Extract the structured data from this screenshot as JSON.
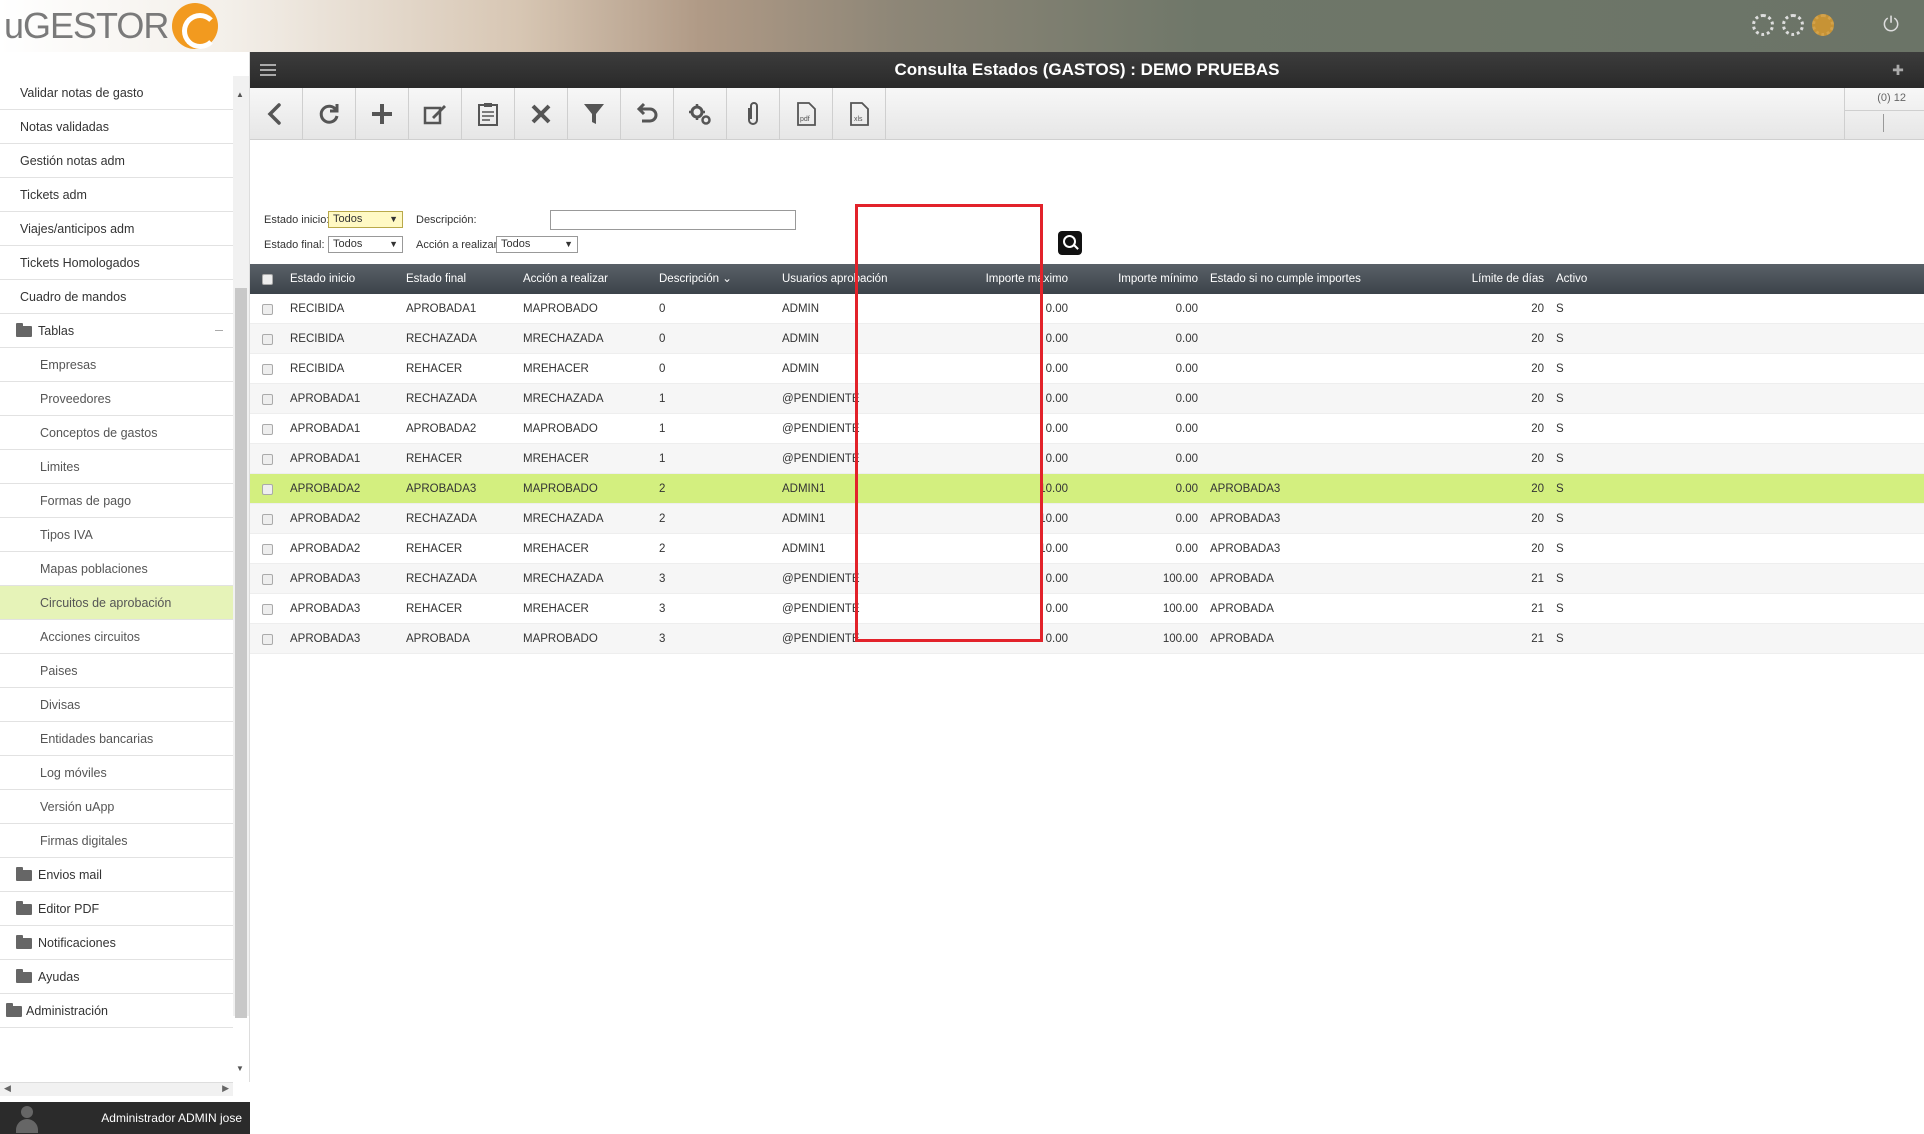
{
  "app": {
    "logo_text": "uGESTOR",
    "page_title": "Consulta Estados (GASTOS) : DEMO PRUEBAS"
  },
  "sidebar": {
    "items": [
      {
        "label": "Validar notas de gasto",
        "type": "item"
      },
      {
        "label": "Notas validadas",
        "type": "item"
      },
      {
        "label": "Gestión notas adm",
        "type": "item"
      },
      {
        "label": "Tickets adm",
        "type": "item"
      },
      {
        "label": "Viajes/anticipos adm",
        "type": "item"
      },
      {
        "label": "Tickets Homologados",
        "type": "item"
      },
      {
        "label": "Cuadro de mandos",
        "type": "item"
      },
      {
        "label": "Tablas",
        "type": "folder"
      },
      {
        "label": "Empresas",
        "type": "sub"
      },
      {
        "label": "Proveedores",
        "type": "sub"
      },
      {
        "label": "Conceptos de gastos",
        "type": "sub"
      },
      {
        "label": "Limites",
        "type": "sub"
      },
      {
        "label": "Formas de pago",
        "type": "sub"
      },
      {
        "label": "Tipos IVA",
        "type": "sub"
      },
      {
        "label": "Mapas poblaciones",
        "type": "sub"
      },
      {
        "label": "Circuitos de aprobación",
        "type": "sub",
        "active": true
      },
      {
        "label": "Acciones circuitos",
        "type": "sub"
      },
      {
        "label": "Paises",
        "type": "sub"
      },
      {
        "label": "Divisas",
        "type": "sub"
      },
      {
        "label": "Entidades bancarias",
        "type": "sub"
      },
      {
        "label": "Log móviles",
        "type": "sub"
      },
      {
        "label": "Versión uApp",
        "type": "sub"
      },
      {
        "label": "Firmas digitales",
        "type": "sub"
      },
      {
        "label": "Envios mail",
        "type": "folder"
      },
      {
        "label": "Editor PDF",
        "type": "folder"
      },
      {
        "label": "Notificaciones",
        "type": "folder"
      },
      {
        "label": "Ayudas",
        "type": "folder"
      },
      {
        "label": "Administración",
        "type": "admin"
      }
    ],
    "user_name": "Administrador ADMIN jose"
  },
  "toolbar": {
    "buttons": [
      "back-icon",
      "refresh-icon",
      "add-icon",
      "edit-icon",
      "clipboard-icon",
      "delete-icon",
      "filter-icon",
      "undo-icon",
      "settings-icon",
      "attachment-icon",
      "pdf-icon",
      "xls-icon"
    ],
    "pdf_label": "pdf",
    "xls_label": "xls",
    "counter": "(0) 12"
  },
  "filters": {
    "estado_inicio_label": "Estado inicio:",
    "estado_inicio_value": "Todos",
    "estado_final_label": "Estado final:",
    "estado_final_value": "Todos",
    "descripcion_label": "Descripción:",
    "descripcion_value": "",
    "accion_label": "Acción a realizar:",
    "accion_value": "Todos"
  },
  "table": {
    "columns": [
      "Estado inicio",
      "Estado final",
      "Acción a realizar",
      "Descripción",
      "Usuarios aprobación",
      "Importe máximo",
      "Importe mínimo",
      "Estado si no cumple importes",
      "Límite de días",
      "Activo"
    ],
    "rows": [
      [
        "RECIBIDA",
        "APROBADA1",
        "MAPROBADO",
        "0",
        "ADMIN",
        "0.00",
        "0.00",
        "",
        "20",
        "S"
      ],
      [
        "RECIBIDA",
        "RECHAZADA",
        "MRECHAZADA",
        "0",
        "ADMIN",
        "0.00",
        "0.00",
        "",
        "20",
        "S"
      ],
      [
        "RECIBIDA",
        "REHACER",
        "MREHACER",
        "0",
        "ADMIN",
        "0.00",
        "0.00",
        "",
        "20",
        "S"
      ],
      [
        "APROBADA1",
        "RECHAZADA",
        "MRECHAZADA",
        "1",
        "@PENDIENTE",
        "0.00",
        "0.00",
        "",
        "20",
        "S"
      ],
      [
        "APROBADA1",
        "APROBADA2",
        "MAPROBADO",
        "1",
        "@PENDIENTE",
        "0.00",
        "0.00",
        "",
        "20",
        "S"
      ],
      [
        "APROBADA1",
        "REHACER",
        "MREHACER",
        "1",
        "@PENDIENTE",
        "0.00",
        "0.00",
        "",
        "20",
        "S"
      ],
      [
        "APROBADA2",
        "APROBADA3",
        "MAPROBADO",
        "2",
        "ADMIN1",
        "10.00",
        "0.00",
        "APROBADA3",
        "20",
        "S"
      ],
      [
        "APROBADA2",
        "RECHAZADA",
        "MRECHAZADA",
        "2",
        "ADMIN1",
        "10.00",
        "0.00",
        "APROBADA3",
        "20",
        "S"
      ],
      [
        "APROBADA2",
        "REHACER",
        "MREHACER",
        "2",
        "ADMIN1",
        "10.00",
        "0.00",
        "APROBADA3",
        "20",
        "S"
      ],
      [
        "APROBADA3",
        "RECHAZADA",
        "MRECHAZADA",
        "3",
        "@PENDIENTE",
        "0.00",
        "100.00",
        "APROBADA",
        "21",
        "S"
      ],
      [
        "APROBADA3",
        "REHACER",
        "MREHACER",
        "3",
        "@PENDIENTE",
        "0.00",
        "100.00",
        "APROBADA",
        "21",
        "S"
      ],
      [
        "APROBADA3",
        "APROBADA",
        "MAPROBADO",
        "3",
        "@PENDIENTE",
        "0.00",
        "100.00",
        "APROBADA",
        "21",
        "S"
      ]
    ],
    "selected_row": 6
  },
  "colors": {
    "selected_row": "#d3ef7f",
    "active_sidebar": "#e6f3b8",
    "highlight_box": "#e2222a",
    "logo_accent": "#f29a1f"
  }
}
